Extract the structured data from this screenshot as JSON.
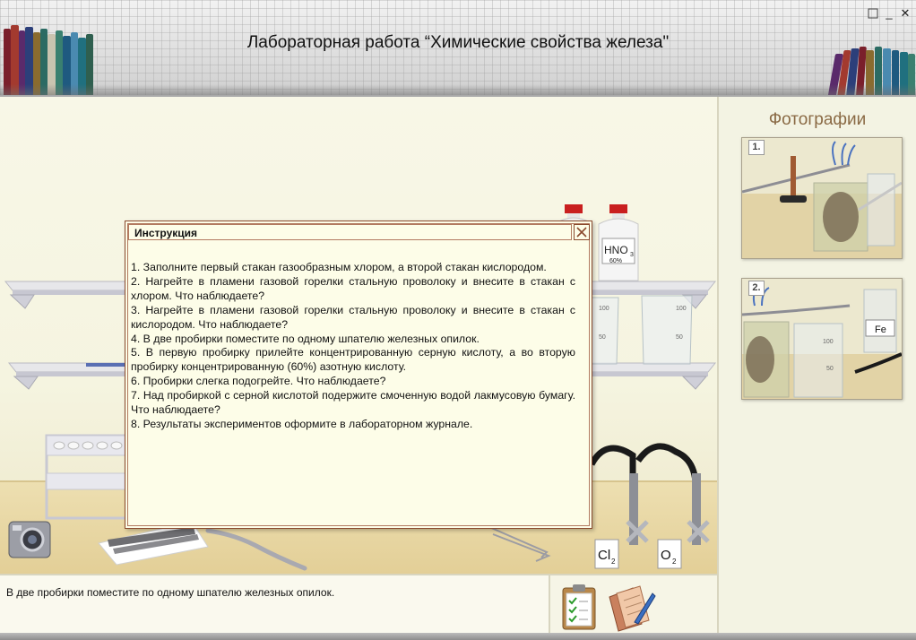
{
  "app": {
    "title": "Лабораторная работа “Химические свойства железа\""
  },
  "window_controls": {
    "minimize": "_",
    "close": "✕"
  },
  "instruction": {
    "title": "Инструкция",
    "steps": [
      "1. Заполните первый стакан газообразным хлором, а второй стакан кислородом.",
      "2. Нагрейте в пламени газовой горелки стальную проволоку и внесите в стакан с хлором. Что наблюдаете?",
      "3. Нагрейте в пламени газовой горелки стальную проволоку и внесите в стакан с кислородом. Что наблюдаете?",
      "4. В две пробирки поместите по одному шпателю железных опилок.",
      "5. В первую пробирку прилейте концентрированную серную кислоту, а во вторую пробирку концентрированную (60%) азотную кислоту.",
      "6. Пробирки слегка подогрейте. Что наблюдаете?",
      "7. Над пробиркой с серной кислотой подержите смоченную водой лакмусовую бумагу. Что наблюдаете?",
      "8. Результаты экспериментов оформите в лабораторном журнале."
    ]
  },
  "lab": {
    "bottle_label_main": "HNO",
    "bottle_label_sub": "3",
    "bottle_percent": "60%",
    "beaker_marks": [
      "100",
      "50"
    ],
    "gas_labels": [
      {
        "main": "Cl",
        "sub": "2"
      },
      {
        "main": "O",
        "sub": "2"
      }
    ]
  },
  "sidebar": {
    "title": "Фотографии",
    "photos": [
      {
        "number": "1.",
        "label": ""
      },
      {
        "number": "2.",
        "label": "Fe"
      }
    ],
    "photo_marks": [
      "100",
      "50"
    ]
  },
  "status": {
    "text": "В две пробирки поместите по одному шпателю железных опилок."
  },
  "colors": {
    "dialog_border": "#8a4a2e",
    "sidebar_title": "#8a6a45",
    "background": "#f3f2e2"
  },
  "icons": [
    "maximize-icon",
    "minimize-icon",
    "close-icon",
    "dialog-close-icon",
    "camera-icon",
    "clipboard-icon",
    "journal-icon"
  ]
}
